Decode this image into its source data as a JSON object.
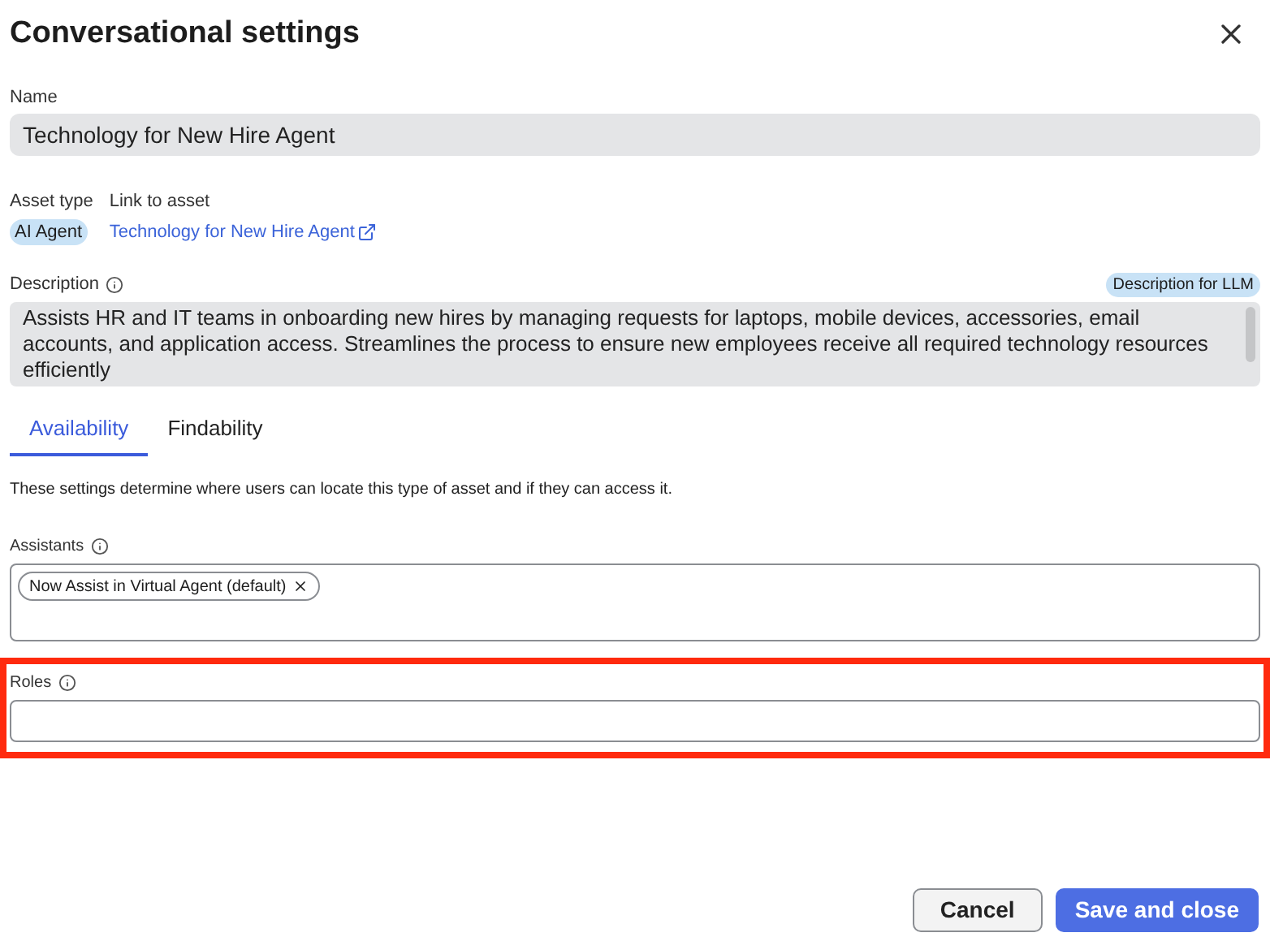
{
  "dialog": {
    "title": "Conversational settings"
  },
  "name_field": {
    "label": "Name",
    "value": "Technology for New Hire Agent"
  },
  "asset_type": {
    "label": "Asset type",
    "value": "AI Agent"
  },
  "asset_link": {
    "label": "Link to asset",
    "value": "Technology for New Hire Agent"
  },
  "description": {
    "label": "Description",
    "badge": "Description for LLM",
    "value": "Assists HR and IT teams in onboarding new hires by managing requests for laptops, mobile devices, accessories, email accounts, and application access. Streamlines the process to ensure new employees receive all required technology resources efficiently"
  },
  "tabs": [
    {
      "label": "Availability",
      "selected": true
    },
    {
      "label": "Findability",
      "selected": false
    }
  ],
  "help_text": "These settings determine where users can locate this type of asset and if they can access it.",
  "assistants": {
    "label": "Assistants",
    "chips": [
      "Now Assist in Virtual Agent (default)"
    ]
  },
  "roles": {
    "label": "Roles",
    "highlighted": true
  },
  "buttons": [
    {
      "label": "Cancel",
      "kind": "secondary"
    },
    {
      "label": "Save and close",
      "kind": "primary"
    }
  ]
}
